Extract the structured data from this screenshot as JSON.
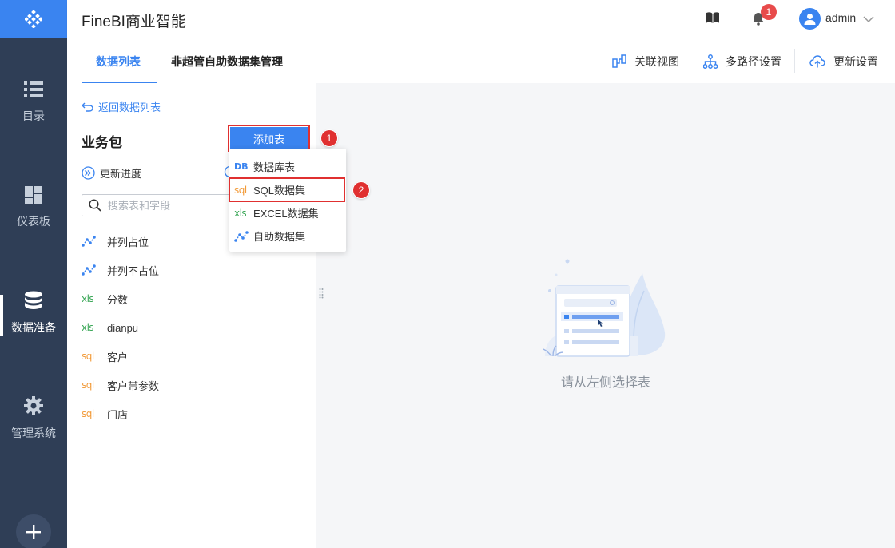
{
  "app": {
    "title": "FineBI商业智能"
  },
  "sidebar": {
    "items": [
      {
        "label": "目录",
        "icon": "list-icon"
      },
      {
        "label": "仪表板",
        "icon": "dashboard-icon"
      },
      {
        "label": "数据准备",
        "icon": "database-icon",
        "active": true
      },
      {
        "label": "管理系统",
        "icon": "gear-icon"
      }
    ],
    "plus_icon": "plus-icon"
  },
  "header": {
    "notification_count": "1",
    "username": "admin"
  },
  "tabs": [
    {
      "label": "数据列表",
      "active": true
    },
    {
      "label": "非超管自助数据集管理",
      "active": false
    }
  ],
  "toolbar": {
    "relation_view": "关联视图",
    "multipath_settings": "多路径设置",
    "update_settings": "更新设置"
  },
  "left_panel": {
    "back_label": "返回数据列表",
    "package_title": "业务包",
    "add_table_label": "添加表",
    "update_progress_label": "更新进度",
    "search_placeholder": "搜索表和字段",
    "tables": [
      {
        "name": "并列占位",
        "type": "self-service"
      },
      {
        "name": "并列不占位",
        "type": "self-service"
      },
      {
        "name": "分数",
        "type": "xls"
      },
      {
        "name": "dianpu",
        "type": "xls"
      },
      {
        "name": "客户",
        "type": "sql"
      },
      {
        "name": "客户带参数",
        "type": "sql"
      },
      {
        "name": "门店",
        "type": "sql"
      }
    ],
    "type_badges": {
      "xls": "xls",
      "sql": "sql",
      "db": "DB"
    }
  },
  "dropdown": {
    "items": [
      {
        "label": "数据库表",
        "type": "db"
      },
      {
        "label": "SQL数据集",
        "type": "sql",
        "highlighted": true
      },
      {
        "label": "EXCEL数据集",
        "type": "xls"
      },
      {
        "label": "自助数据集",
        "type": "self-service"
      }
    ]
  },
  "steps": {
    "one": "1",
    "two": "2"
  },
  "main": {
    "empty_text": "请从左侧选择表"
  },
  "colors": {
    "accent": "#3a84f0",
    "sidebar_bg": "#2f3e56",
    "highlight_red": "#e03030",
    "xls_green": "#3aa757",
    "sql_orange": "#f29b3a"
  }
}
